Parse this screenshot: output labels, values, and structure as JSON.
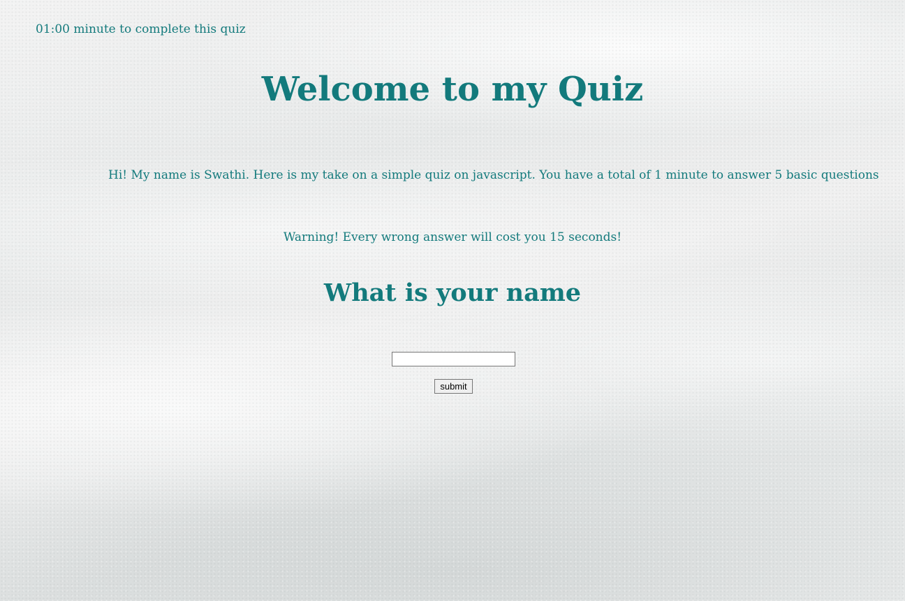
{
  "timer": {
    "text": "01:00 minute to complete this quiz"
  },
  "header": {
    "title": "Welcome to my Quiz"
  },
  "intro": {
    "text": "Hi! My name is Swathi. Here is my take on a simple quiz on javascript. You have a total of 1 minute to answer 5 basic questions"
  },
  "warning": {
    "text": "Warning! Every wrong answer will cost you 15 seconds!"
  },
  "form": {
    "question": "What is your name",
    "name_value": "",
    "name_placeholder": "",
    "submit_label": "submit"
  },
  "colors": {
    "text_accent": "#137a7c",
    "background": "#e9ebeb"
  }
}
